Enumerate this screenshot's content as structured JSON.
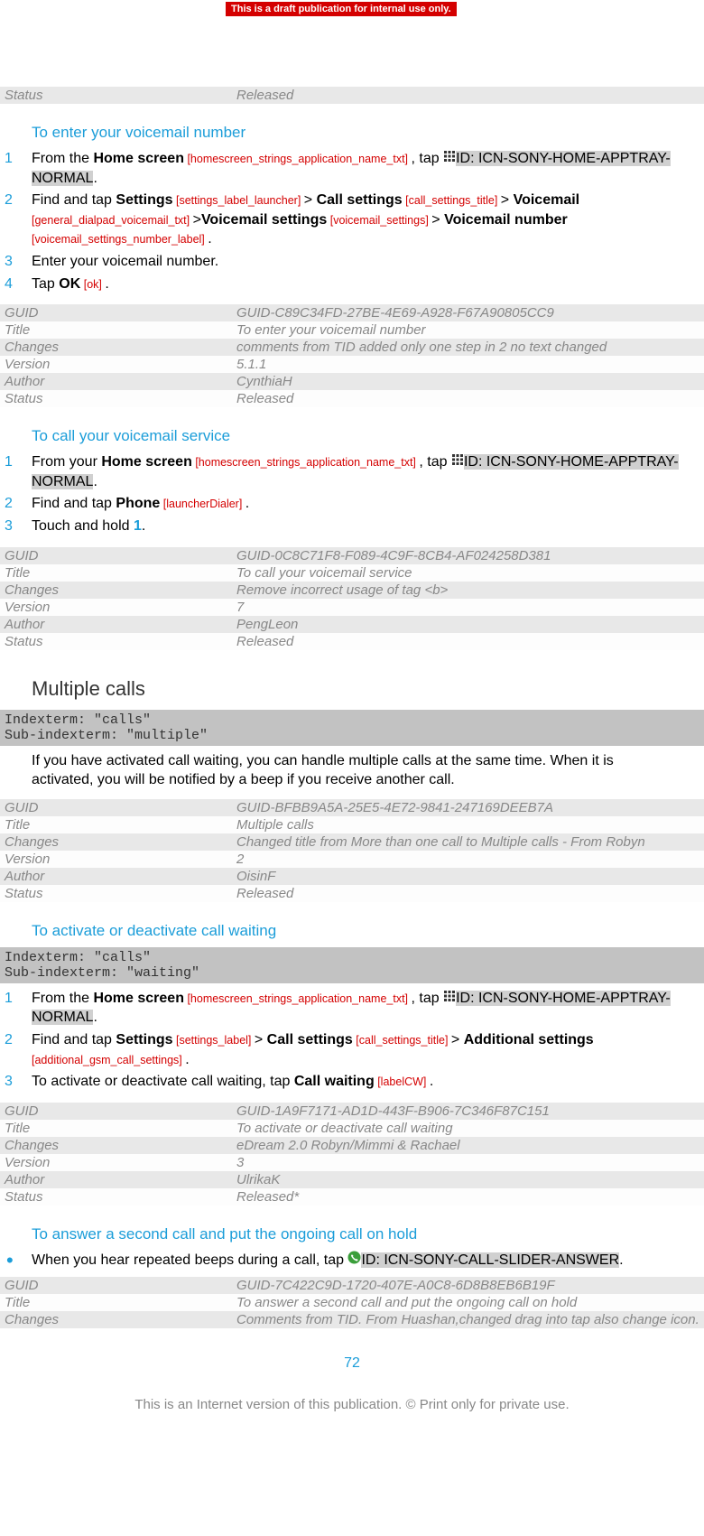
{
  "banner": "This is a draft publication for internal use only.",
  "top_status": {
    "label": "Status",
    "value": "Released"
  },
  "section1": {
    "title": "To enter your voicemail number",
    "step1_a": "From the ",
    "step1_b": "Home screen",
    "step1_ref1": " [homescreen_strings_application_name_txt] ",
    "step1_c": ", tap ",
    "step1_icon_id": "ID: ICN-SONY-HOME-APPTRAY-NORMAL",
    "step1_d": ".",
    "step2_a": "Find and tap ",
    "step2_b": "Settings",
    "step2_ref1": " [settings_label_launcher] ",
    "step2_c": "> ",
    "step2_d": "Call settings",
    "step2_ref2": " [call_settings_title] ",
    "step2_e": "> ",
    "step2_f": "Voicemail",
    "step2_ref3": " [general_dialpad_voicemail_txt] ",
    "step2_g": ">",
    "step2_h": "Voicemail settings",
    "step2_ref4": " [voicemail_settings] ",
    "step2_i": "> ",
    "step2_j": "Voicemail number",
    "step2_ref5": " [voicemail_settings_number_label] ",
    "step2_k": ".",
    "step3": "Enter your voicemail number.",
    "step4_a": "Tap ",
    "step4_b": "OK",
    "step4_ref1": " [ok] ",
    "step4_c": "."
  },
  "meta1": {
    "guid_l": "GUID",
    "guid_v": "GUID-C89C34FD-27BE-4E69-A928-F67A90805CC9",
    "title_l": "Title",
    "title_v": "To enter your voicemail number",
    "chg_l": "Changes",
    "chg_v": "comments from TID added only one step in 2 no text changed",
    "ver_l": "Version",
    "ver_v": "5.1.1",
    "auth_l": "Author",
    "auth_v": "CynthiaH",
    "stat_l": "Status",
    "stat_v": "Released"
  },
  "section2": {
    "title": "To call your voicemail service",
    "step1_a": "From your ",
    "step1_b": "Home screen",
    "step1_ref1": " [homescreen_strings_application_name_txt] ",
    "step1_c": ", tap ",
    "step1_icon_id": "ID: ICN-SONY-HOME-APPTRAY-NORMAL",
    "step1_d": ".",
    "step2_a": "Find and tap ",
    "step2_b": "Phone",
    "step2_ref1": " [launcherDialer] ",
    "step2_c": ".",
    "step3_a": "Touch and hold ",
    "step3_b": "1",
    "step3_c": "."
  },
  "meta2": {
    "guid_l": "GUID",
    "guid_v": "GUID-0C8C71F8-F089-4C9F-8CB4-AF024258D381",
    "title_l": "Title",
    "title_v": "To call your voicemail service",
    "chg_l": "Changes",
    "chg_v": "Remove incorrect usage of tag <b>",
    "ver_l": "Version",
    "ver_v": "7",
    "auth_l": "Author",
    "auth_v": "PengLeon",
    "stat_l": "Status",
    "stat_v": "Released"
  },
  "section3": {
    "title": "Multiple calls",
    "idx1": "Indexterm: \"calls\"",
    "idx2": "Sub-indexterm: \"multiple\"",
    "para": "If you have activated call waiting, you can handle multiple calls at the same time. When it is activated, you will be notified by a beep if you receive another call."
  },
  "meta3": {
    "guid_l": "GUID",
    "guid_v": "GUID-BFBB9A5A-25E5-4E72-9841-247169DEEB7A",
    "title_l": "Title",
    "title_v": "Multiple calls",
    "chg_l": "Changes",
    "chg_v": "Changed title from More than one call to Multiple calls - From Robyn",
    "ver_l": "Version",
    "ver_v": "2",
    "auth_l": "Author",
    "auth_v": "OisinF",
    "stat_l": "Status",
    "stat_v": "Released"
  },
  "section4": {
    "title": "To activate or deactivate call waiting",
    "idx1": "Indexterm: \"calls\"",
    "idx2": "Sub-indexterm: \"waiting\"",
    "step1_a": "From the ",
    "step1_b": "Home screen",
    "step1_ref1": " [homescreen_strings_application_name_txt] ",
    "step1_c": ", tap ",
    "step1_icon_id": "ID: ICN-SONY-HOME-APPTRAY-NORMAL",
    "step1_d": ".",
    "step2_a": "Find and tap ",
    "step2_b": "Settings",
    "step2_ref1": " [settings_label] ",
    "step2_c": "> ",
    "step2_d": "Call settings",
    "step2_ref2": " [call_settings_title] ",
    "step2_e": "> ",
    "step2_f": "Additional settings",
    "step2_ref3": " [additional_gsm_call_settings] ",
    "step2_g": ".",
    "step3_a": "To activate or deactivate call waiting, tap ",
    "step3_b": "Call waiting",
    "step3_ref1": " [labelCW] ",
    "step3_c": "."
  },
  "meta4": {
    "guid_l": "GUID",
    "guid_v": "GUID-1A9F7171-AD1D-443F-B906-7C346F87C151",
    "title_l": "Title",
    "title_v": "To activate or deactivate call waiting",
    "chg_l": "Changes",
    "chg_v": "eDream 2.0 Robyn/Mimmi & Rachael",
    "ver_l": "Version",
    "ver_v": "3",
    "auth_l": "Author",
    "auth_v": "UlrikaK",
    "stat_l": "Status",
    "stat_v": "Released*"
  },
  "section5": {
    "title": "To answer a second call and put the ongoing call on hold",
    "b1_a": "When you hear repeated beeps during a call, tap ",
    "b1_icon_id": "ID: ICN-SONY-CALL-SLIDER-ANSWER",
    "b1_b": "."
  },
  "meta5": {
    "guid_l": "GUID",
    "guid_v": "GUID-7C422C9D-1720-407E-A0C8-6D8B8EB6B19F",
    "title_l": "Title",
    "title_v": "To answer a second call and put the ongoing call on hold",
    "chg_l": "Changes",
    "chg_v": "Comments from TID. From Huashan,changed drag into tap also change icon."
  },
  "page_number": "72",
  "footer": "This is an Internet version of this publication. © Print only for private use."
}
